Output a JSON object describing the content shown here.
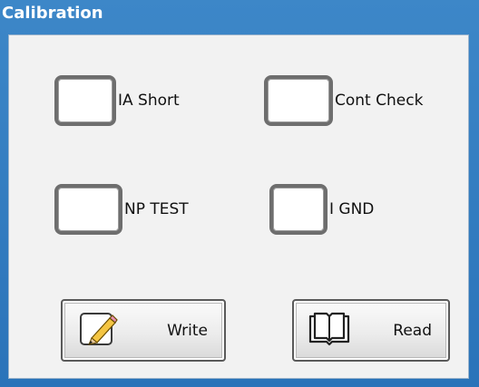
{
  "window": {
    "title": "Calibration"
  },
  "checkboxes": [
    {
      "label": "IA Short",
      "checked": false
    },
    {
      "label": "Cont Check",
      "checked": false
    },
    {
      "label": "NP TEST",
      "checked": false
    },
    {
      "label": "I GND",
      "checked": false
    }
  ],
  "buttons": {
    "write": {
      "label": "Write",
      "icon": "write-pencil-icon"
    },
    "read": {
      "label": "Read",
      "icon": "open-book-icon"
    }
  },
  "colors": {
    "title_bar": "#2a73b9",
    "panel_background": "#f2f2f2",
    "checkbox_border": "#6e6e6e"
  }
}
